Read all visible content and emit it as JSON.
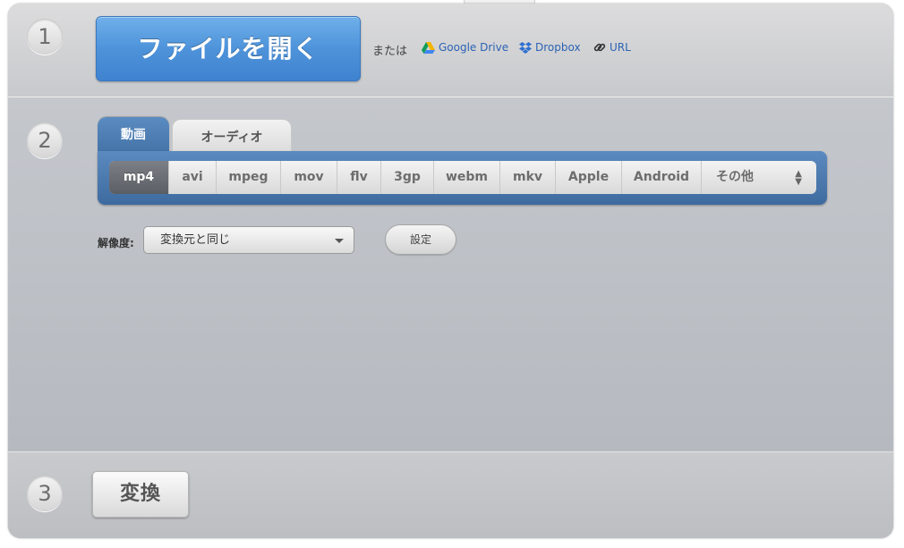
{
  "steps": {
    "one": "1",
    "two": "2",
    "three": "3"
  },
  "source": {
    "open_file_label": "ファイルを開く",
    "or_label": "または",
    "links": [
      {
        "label": "Google Drive",
        "icon": "google-drive-icon"
      },
      {
        "label": "Dropbox",
        "icon": "dropbox-icon"
      },
      {
        "label": "URL",
        "icon": "link-icon"
      }
    ]
  },
  "tabs": [
    {
      "label": "動画",
      "active": true
    },
    {
      "label": "オーディオ",
      "active": false
    }
  ],
  "formats": [
    "mp4",
    "avi",
    "mpeg",
    "mov",
    "flv",
    "3gp",
    "webm",
    "mkv",
    "Apple",
    "Android",
    "その他"
  ],
  "selected_format": "mp4",
  "resolution": {
    "label": "解像度:",
    "value": "変換元と同じ"
  },
  "settings_label": "設定",
  "convert_label": "変換",
  "colors": {
    "accent_blue": "#4e93da",
    "tab_blue": "#4574a8",
    "link_blue": "#2c63b3"
  }
}
